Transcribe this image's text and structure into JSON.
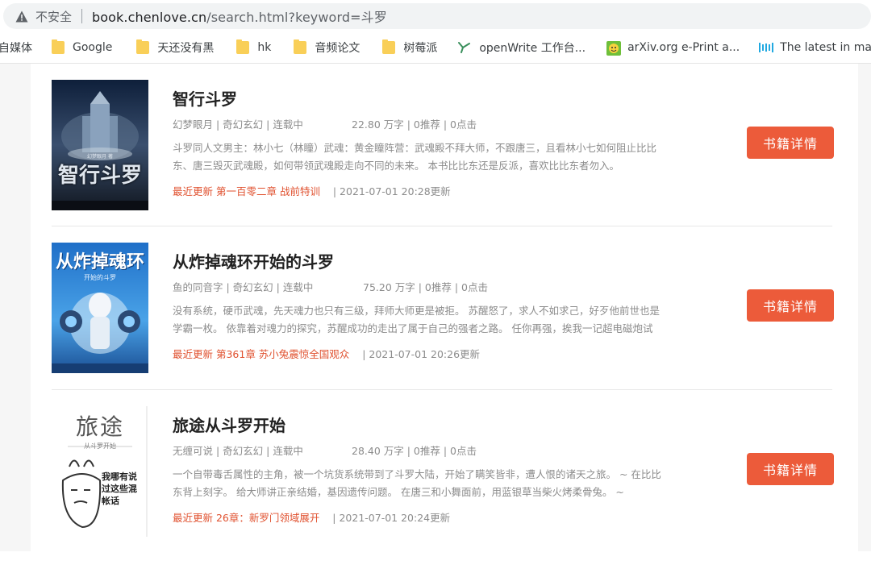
{
  "browser": {
    "security_text": "不安全",
    "url_host": "book.chenlove.cn",
    "url_path": "/search.html?keyword=斗罗"
  },
  "bookmarks": [
    {
      "label": "自媒体",
      "icon": "none"
    },
    {
      "label": "Google",
      "icon": "folder-icon"
    },
    {
      "label": "天还没有黑",
      "icon": "folder-icon"
    },
    {
      "label": "hk",
      "icon": "folder-icon"
    },
    {
      "label": "音频论文",
      "icon": "folder-icon"
    },
    {
      "label": "树莓派",
      "icon": "folder-icon"
    },
    {
      "label": "openWrite 工作台...",
      "icon": "openwrite-icon"
    },
    {
      "label": "arXiv.org e-Print a...",
      "icon": "arxiv-icon"
    },
    {
      "label": "The latest in mac...",
      "icon": "paperswithcode-icon"
    }
  ],
  "books": [
    {
      "title": "智行斗罗",
      "meta": "幻梦眼月 | 奇幻玄幻 | 连载中",
      "stats": "22.80 万字 | 0推荐 | 0点击",
      "desc": "斗罗同人文男主：林小七（林瞳）武魂：黄金瞳阵营：武魂殿不拜大师，不跟唐三，且看林小七如何阻止比比东、唐三毁灭武魂殿，如何带领武魂殿走向不同的未来。 本书比比东还是反派，喜欢比比东者勿入。",
      "update_label": "最近更新 第一百零二章 战前特训",
      "update_time": "| 2021-07-01 20:28更新",
      "button": "书籍详情",
      "cover_text": "智行斗罗",
      "cover_small": "幻梦眼月 著"
    },
    {
      "title": "从炸掉魂环开始的斗罗",
      "meta": "鱼的同音字 | 奇幻玄幻 | 连载中",
      "stats": "75.20 万字 | 0推荐 | 0点击",
      "desc": "没有系统，硬币武魂，先天魂力也只有三级，拜师大师更是被拒。 苏醒怒了，求人不如求己，好歹他前世也是学霸一枚。 依靠着对魂力的探究，苏醒成功的走出了属于自己的强者之路。 任你再强，挨我一记超电磁炮试试。",
      "update_label": "最近更新 第361章 苏小兔震惊全国观众",
      "update_time": "| 2021-07-01 20:26更新",
      "button": "书籍详情",
      "cover_text": "从炸掉魂环",
      "cover_small": "开始的斗罗"
    },
    {
      "title": "旅途从斗罗开始",
      "meta": "无缠可说 | 奇幻玄幻 | 连载中",
      "stats": "28.40 万字 | 0推荐 | 0点击",
      "desc": "一个自带毒舌属性的主角，被一个坑货系统带到了斗罗大陆，开始了瞒笑皆非，遭人恨的诸天之旅。 ~ 在比比东背上刻字。 给大师讲正亲结婚，基因遗传问题。 在唐三和小舞面前，用蓝银草当柴火烤柔骨兔。 ~",
      "update_label": "最近更新 26章：新罗门领域展开",
      "update_time": "| 2021-07-01 20:24更新",
      "button": "书籍详情",
      "cover_text": "旅途",
      "cover_small": "从斗罗开始",
      "cover_bubble": "我哪有说过这些混帐话"
    }
  ]
}
